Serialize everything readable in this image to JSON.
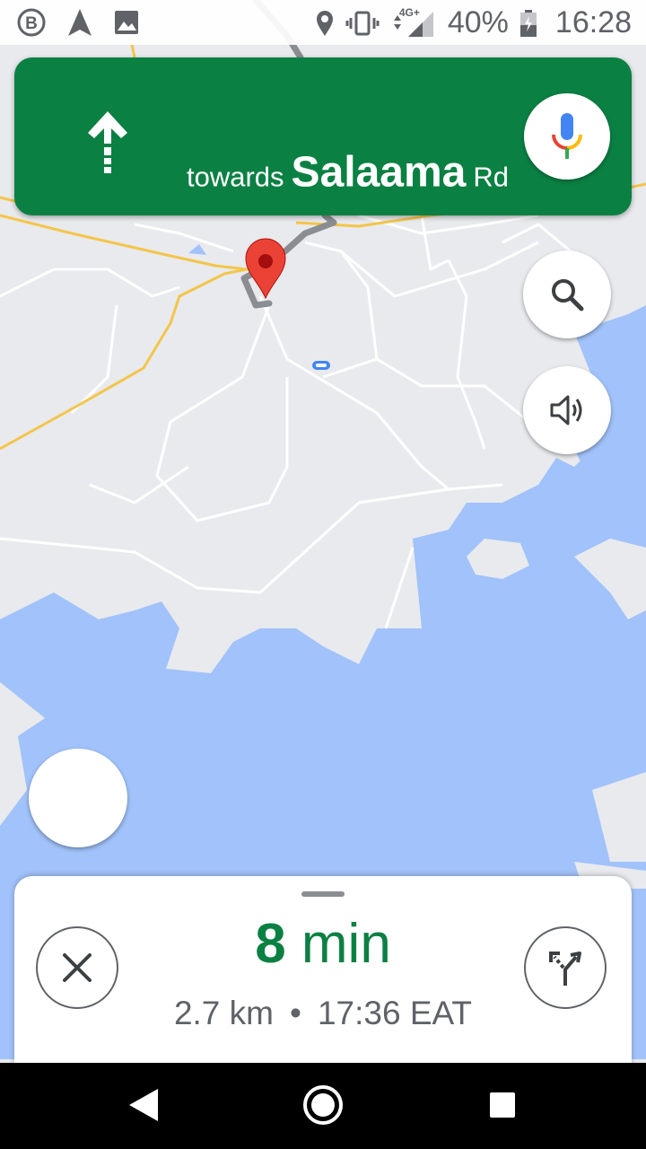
{
  "status_bar": {
    "battery": "40%",
    "time": "16:28",
    "network": "4G+"
  },
  "banner": {
    "towards": "towards",
    "street_name": "Salaama",
    "street_suffix": "Rd"
  },
  "trip": {
    "duration_value": "8",
    "duration_unit": "min",
    "distance": "2.7 km",
    "separator": "•",
    "arrival": "17:36 EAT"
  },
  "colors": {
    "banner_green": "#0b8043",
    "water": "#a1c2fa",
    "land": "#e8eaed",
    "pin_red": "#ea4335"
  },
  "icons": {
    "turn": "straight-arrow-icon",
    "mic": "mic-icon",
    "search": "search-icon",
    "sound": "volume-icon",
    "close": "close-icon",
    "routes": "alternate-routes-icon"
  }
}
